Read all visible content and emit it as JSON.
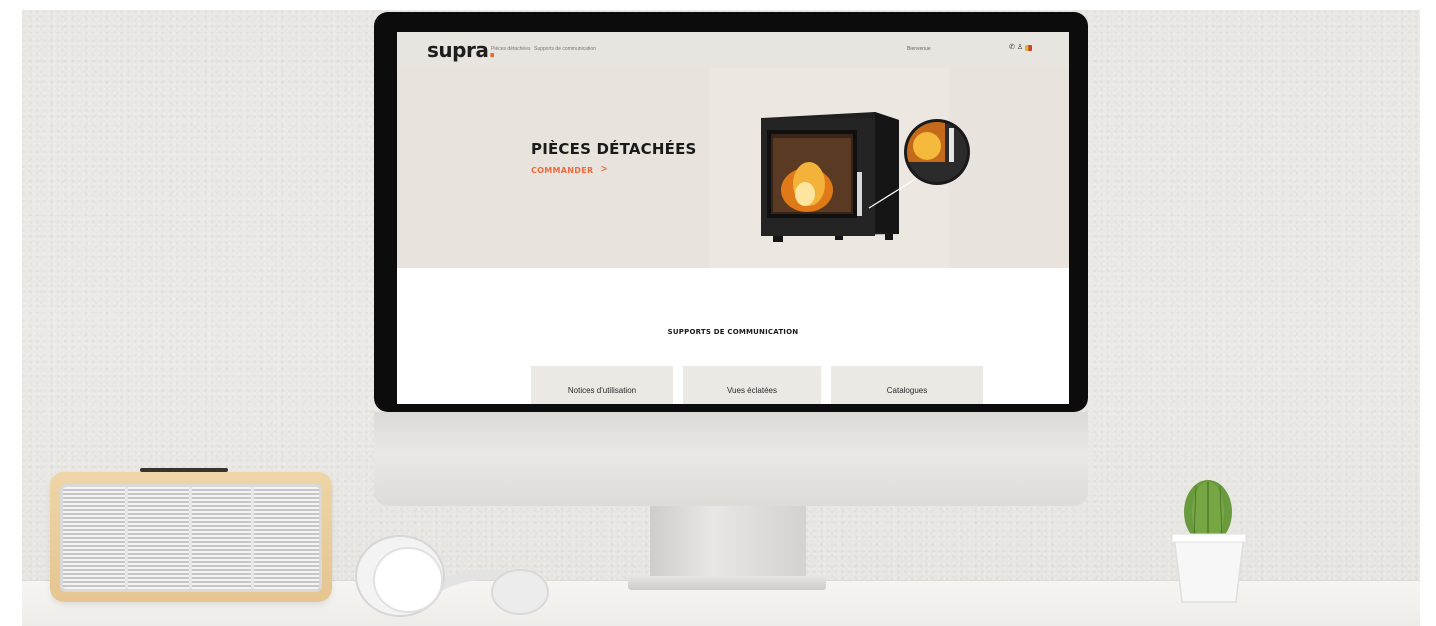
{
  "screen": {
    "header": {
      "logo": "supra",
      "nav": [
        "Pièces détachées",
        "Supports de communication"
      ],
      "welcome": "Bienvenue"
    },
    "hero": {
      "title": "PIÈCES DÉTACHÉES",
      "cta": "COMMANDER",
      "cta_arrow": ">"
    },
    "section": {
      "title": "SUPPORTS DE COMMUNICATION",
      "cards": [
        "Notices d'utilisation",
        "Vues éclatées",
        "Catalogues"
      ]
    }
  },
  "colors": {
    "accent": "#ef6a3c",
    "hero_bg": "#e8e3dd",
    "card_bg": "#ece8e3"
  },
  "icons": [
    "phone-icon",
    "user-icon",
    "flag-icon"
  ]
}
